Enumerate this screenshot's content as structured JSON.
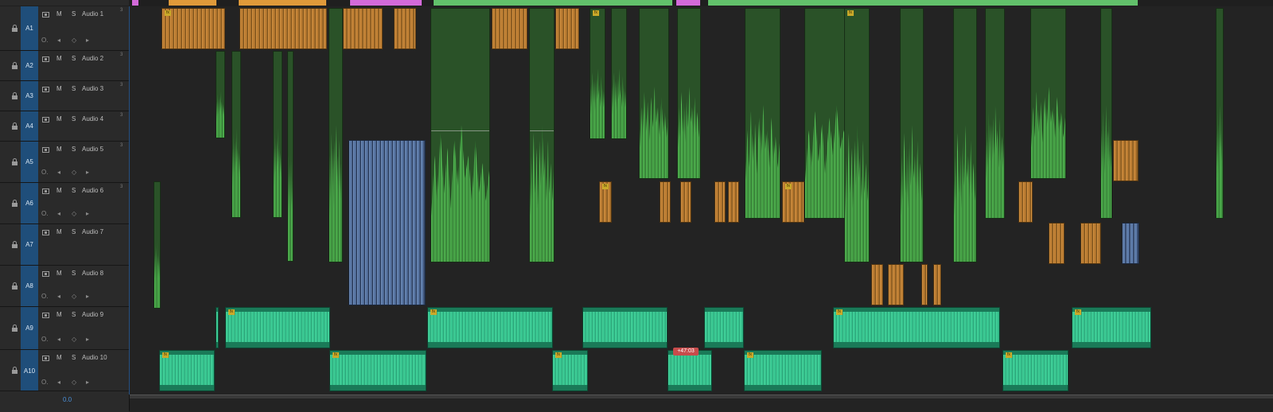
{
  "top_strip": {
    "label": "",
    "colors": [
      "#d36ad9",
      "#e09a3a",
      "#62c16b"
    ]
  },
  "tracks": [
    {
      "id": "A1",
      "name": "Audio 1",
      "m": "M",
      "s": "S"
    },
    {
      "id": "A2",
      "name": "Audio 2",
      "m": "M",
      "s": "S"
    },
    {
      "id": "A3",
      "name": "Audio 3",
      "m": "M",
      "s": "S"
    },
    {
      "id": "A4",
      "name": "Audio 4",
      "m": "M",
      "s": "S"
    },
    {
      "id": "A5",
      "name": "Audio 5",
      "m": "M",
      "s": "S"
    },
    {
      "id": "A6",
      "name": "Audio 6",
      "m": "M",
      "s": "S"
    },
    {
      "id": "A7",
      "name": "Audio 7",
      "m": "M",
      "s": "S"
    },
    {
      "id": "A8",
      "name": "Audio 8",
      "m": "M",
      "s": "S"
    },
    {
      "id": "A9",
      "name": "Audio 9",
      "m": "M",
      "s": "S"
    },
    {
      "id": "A10",
      "name": "Audio 10",
      "m": "M",
      "s": "S"
    }
  ],
  "footer": {
    "value": "0.0"
  },
  "timeline": {
    "badge": "+47:03"
  },
  "colors": {
    "green": "#4aa84a",
    "orange": "#e09a3a",
    "blue": "#6f8fc4",
    "teal": "#33c28d",
    "track_id_bg": "#1f4e7a"
  }
}
